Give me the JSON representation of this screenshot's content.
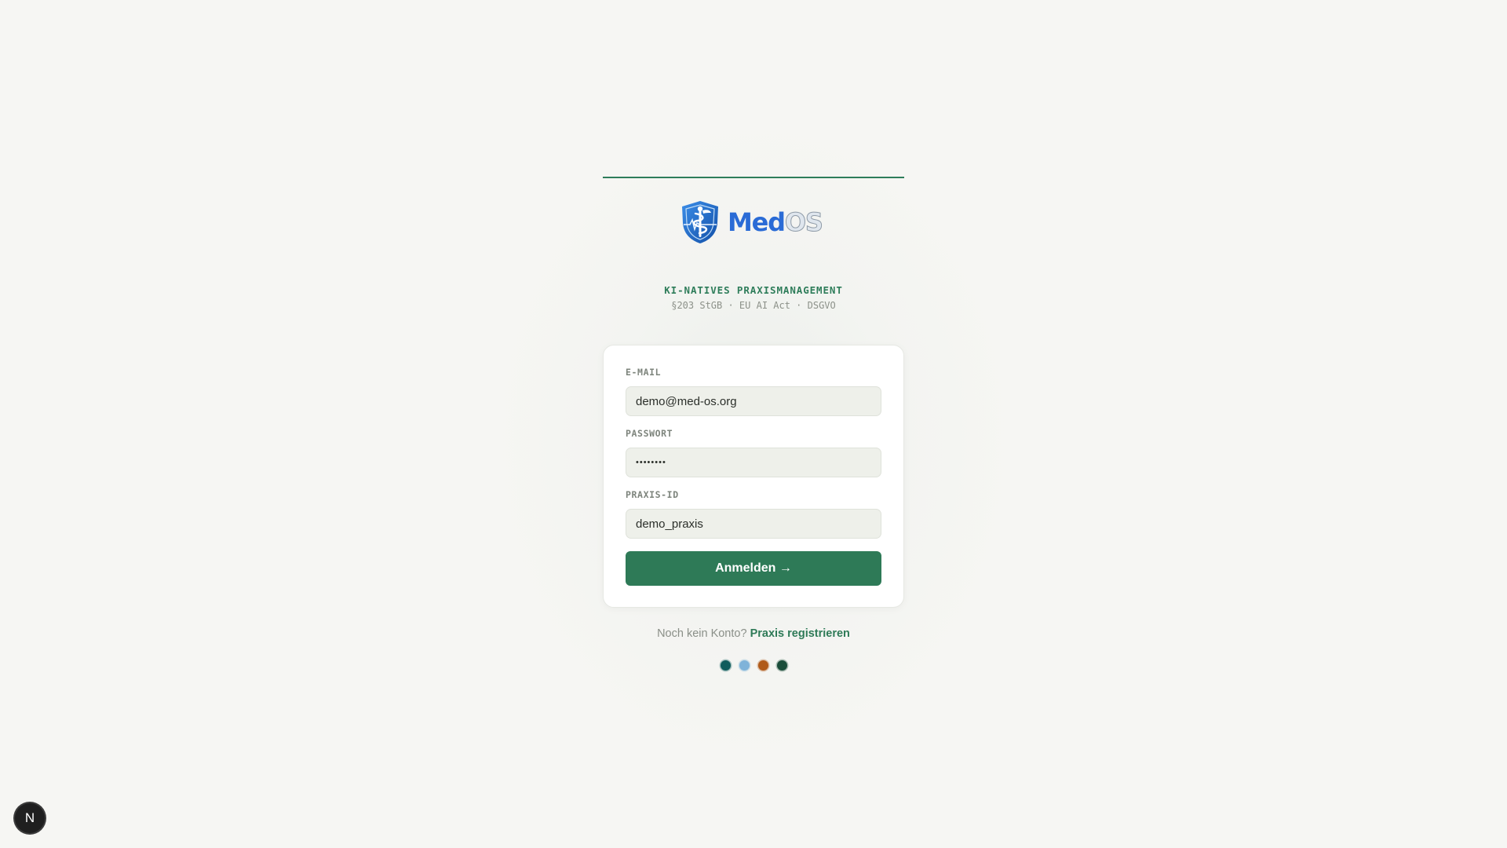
{
  "brand": {
    "name_part1": "Med",
    "name_part2": "OS",
    "tagline": "KI-NATIVES PRAXISMANAGEMENT",
    "compliance": "§203 StGB · EU AI Act · DSGVO"
  },
  "login_form": {
    "email": {
      "label": "E-MAIL",
      "value": "demo@med-os.org"
    },
    "password": {
      "label": "PASSWORT",
      "value": "••••••••"
    },
    "practice_id": {
      "label": "PRAXIS-ID",
      "value": "demo_praxis"
    },
    "submit_label": "Anmelden →"
  },
  "register": {
    "prompt": "Noch kein Konto?",
    "link_label": "Praxis registrieren"
  },
  "status_dots": [
    {
      "name": "status-dot-1",
      "color": "#0f5c5c"
    },
    {
      "name": "status-dot-2",
      "color": "#7fb3d9"
    },
    {
      "name": "status-dot-3",
      "color": "#b05a1a"
    },
    {
      "name": "status-dot-4",
      "color": "#1a4d3a"
    }
  ],
  "dev_badge": {
    "label": "N"
  },
  "colors": {
    "accent": "#2e7a57",
    "brand_blue": "#2a6bd6",
    "background": "#f6f6f3"
  }
}
